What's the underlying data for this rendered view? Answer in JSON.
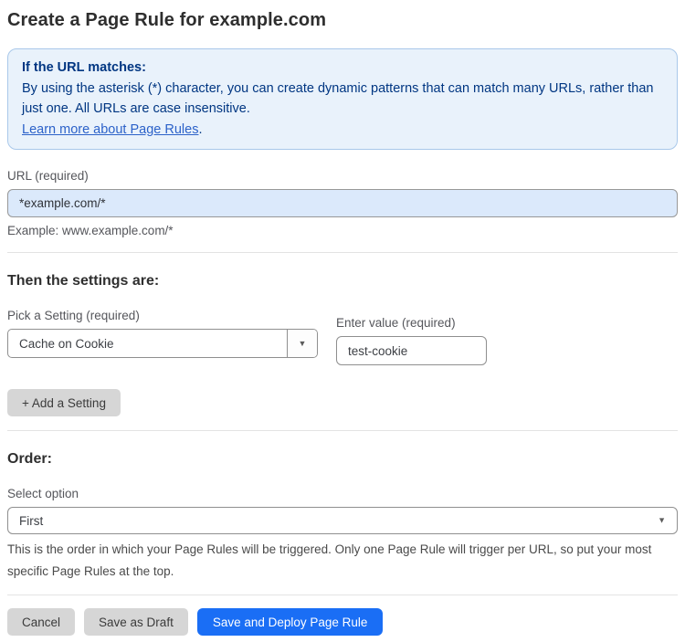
{
  "page": {
    "title": "Create a Page Rule for example.com"
  },
  "info_box": {
    "heading": "If the URL matches:",
    "body": "By using the asterisk (*) character, you can create dynamic patterns that can match many URLs, rather than just one. All URLs are case insensitive.",
    "link_label": "Learn more about Page Rules",
    "link_suffix": "."
  },
  "url_field": {
    "label": "URL (required)",
    "value": "*example.com/*",
    "helper": "Example: www.example.com/*"
  },
  "settings": {
    "heading": "Then the settings are:",
    "setting_label": "Pick a Setting (required)",
    "setting_value": "Cache on Cookie",
    "value_label": "Enter value (required)",
    "value_value": "test-cookie",
    "add_button_label": "+ Add a Setting"
  },
  "order": {
    "heading": "Order:",
    "select_label": "Select option",
    "select_value": "First",
    "description": "This is the order in which your Page Rules will be triggered. Only one Page Rule will trigger per URL, so put your most specific Page Rules at the top."
  },
  "footer": {
    "cancel_label": "Cancel",
    "save_draft_label": "Save as Draft",
    "save_deploy_label": "Save and Deploy Page Rule"
  },
  "icons": {
    "dropdown_arrow": "▼"
  },
  "colors": {
    "info_box_bg": "#e9f2fb",
    "info_box_border": "#a9c8ea",
    "info_box_text": "#003682",
    "link_blue": "#2c62c9",
    "url_input_bg": "#dbe9fb",
    "gray_button_bg": "#d6d6d6",
    "primary_button_bg": "#1a6ef5"
  }
}
